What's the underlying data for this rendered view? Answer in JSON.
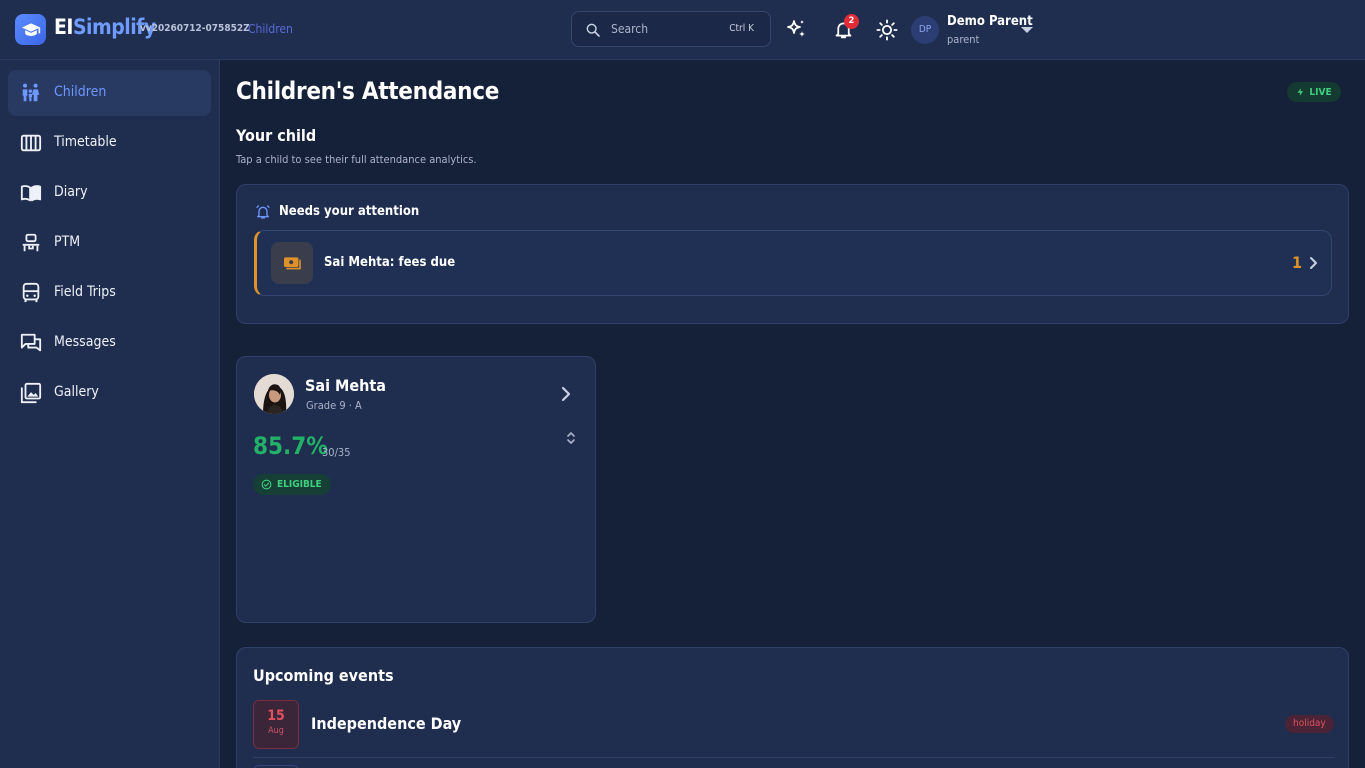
{
  "app": {
    "brand_part1": "EI",
    "brand_part2": "Simplify",
    "version": "vv20260712-075852Z",
    "breadcrumb": "Children"
  },
  "search": {
    "placeholder": "Search",
    "shortcut": "Ctrl K"
  },
  "notifications": {
    "count": "2"
  },
  "user": {
    "initials": "DP",
    "name": "Demo Parent",
    "role": "parent"
  },
  "sidebar": {
    "items": [
      {
        "label": "Children",
        "icon": "children-icon",
        "active": true
      },
      {
        "label": "Timetable",
        "icon": "timetable-icon",
        "active": false
      },
      {
        "label": "Diary",
        "icon": "diary-icon",
        "active": false
      },
      {
        "label": "PTM",
        "icon": "ptm-icon",
        "active": false
      },
      {
        "label": "Field Trips",
        "icon": "bus-icon",
        "active": false
      },
      {
        "label": "Messages",
        "icon": "messages-icon",
        "active": false
      },
      {
        "label": "Gallery",
        "icon": "gallery-icon",
        "active": false
      }
    ]
  },
  "main": {
    "title": "Children's Attendance",
    "live_label": "LIVE",
    "section_title": "Your child",
    "section_subtitle": "Tap a child to see their full attendance analytics."
  },
  "attention": {
    "title": "Needs your attention",
    "items": [
      {
        "text": "Sai Mehta: fees due",
        "count": "1"
      }
    ]
  },
  "child": {
    "name": "Sai Mehta",
    "grade": "Grade 9 · A",
    "percentage": "85.7%",
    "fraction": "30/35",
    "status": "ELIGIBLE"
  },
  "events": {
    "title": "Upcoming events",
    "items": [
      {
        "day": "15",
        "month": "Aug",
        "name": "Independence Day",
        "tag": "holiday"
      }
    ]
  },
  "colors": {
    "background": "#152039",
    "panel": "#1f2d4f",
    "accent": "#6e97ff",
    "success": "#23b067",
    "warning": "#e0922a",
    "danger": "#e0505f"
  }
}
